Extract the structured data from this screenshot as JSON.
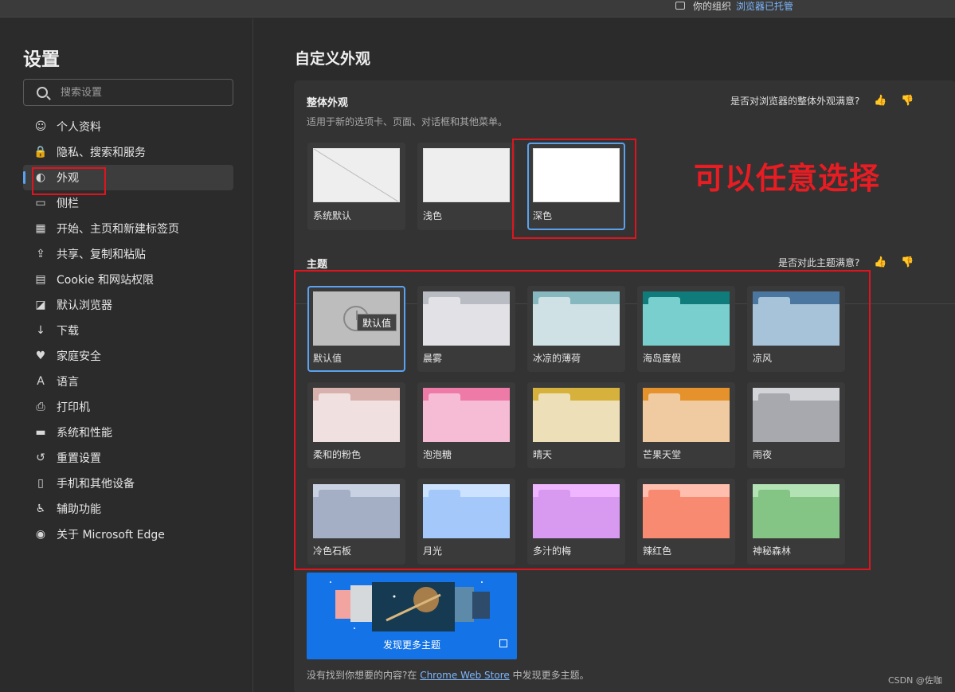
{
  "topbar": {
    "managed_prefix": "你的组织",
    "managed_link": "浏览器已托管"
  },
  "sidebar": {
    "title": "设置",
    "search_placeholder": "搜索设置",
    "items": [
      {
        "label": "个人资料",
        "icon": "profile-icon"
      },
      {
        "label": "隐私、搜索和服务",
        "icon": "lock-icon"
      },
      {
        "label": "外观",
        "icon": "palette-icon",
        "active": true
      },
      {
        "label": "侧栏",
        "icon": "sidebar-icon"
      },
      {
        "label": "开始、主页和新建标签页",
        "icon": "home-grid-icon"
      },
      {
        "label": "共享、复制和粘贴",
        "icon": "share-icon"
      },
      {
        "label": "Cookie 和网站权限",
        "icon": "site-permissions-icon"
      },
      {
        "label": "默认浏览器",
        "icon": "browser-icon"
      },
      {
        "label": "下载",
        "icon": "download-icon"
      },
      {
        "label": "家庭安全",
        "icon": "family-icon"
      },
      {
        "label": "语言",
        "icon": "language-icon"
      },
      {
        "label": "打印机",
        "icon": "printer-icon"
      },
      {
        "label": "系统和性能",
        "icon": "laptop-icon"
      },
      {
        "label": "重置设置",
        "icon": "reset-icon"
      },
      {
        "label": "手机和其他设备",
        "icon": "phone-icon"
      },
      {
        "label": "辅助功能",
        "icon": "accessibility-icon"
      },
      {
        "label": "关于 Microsoft Edge",
        "icon": "edge-logo-icon"
      }
    ]
  },
  "main": {
    "page_title": "自定义外观",
    "appearance": {
      "title": "整体外观",
      "description": "适用于新的选项卡、页面、对话框和其他菜单。",
      "feedback": "是否对浏览器的整体外观满意?",
      "options": [
        {
          "label": "系统默认"
        },
        {
          "label": "浅色"
        },
        {
          "label": "深色",
          "selected": true
        }
      ]
    },
    "themes": {
      "title": "主题",
      "feedback": "是否对此主题满意?",
      "tooltip": "默认值",
      "items": [
        {
          "label": "默认值",
          "selected": true,
          "bar": "#bdbdbd",
          "tab": "#bdbdbd",
          "body": "#bdbdbd"
        },
        {
          "label": "晨雾",
          "bar": "#b9bcc2",
          "tab": "#e2e2e6",
          "body": "#e2e2e6"
        },
        {
          "label": "冰凉的薄荷",
          "bar": "#86b8c0",
          "tab": "#cfe1e4",
          "body": "#cfe1e4"
        },
        {
          "label": "海岛度假",
          "bar": "#0f7b7b",
          "tab": "#78cfcd",
          "body": "#78cfcd"
        },
        {
          "label": "凉风",
          "bar": "#4a76a0",
          "tab": "#a7c3d9",
          "body": "#a7c3d9"
        },
        {
          "label": "柔和的粉色",
          "bar": "#d8b1ad",
          "tab": "#f0e0df",
          "body": "#f0e0df"
        },
        {
          "label": "泡泡糖",
          "bar": "#ee7aa8",
          "tab": "#f7bcd5",
          "body": "#f7bcd5"
        },
        {
          "label": "晴天",
          "bar": "#d6b23c",
          "tab": "#ede0b8",
          "body": "#ede0b8"
        },
        {
          "label": "芒果天堂",
          "bar": "#e6922c",
          "tab": "#f0cba1",
          "body": "#f0cba1"
        },
        {
          "label": "雨夜",
          "bar": "#d3d4d8",
          "tab": "#a8a9ae",
          "body": "#a8a9ae"
        },
        {
          "label": "冷色石板",
          "bar": "#c9d2e2",
          "tab": "#a4afc6",
          "body": "#a4afc6"
        },
        {
          "label": "月光",
          "bar": "#cce2ff",
          "tab": "#a5c8fb",
          "body": "#a5c8fb"
        },
        {
          "label": "多汁的梅",
          "bar": "#efb6ff",
          "tab": "#d89af0",
          "body": "#d89af0"
        },
        {
          "label": "辣红色",
          "bar": "#ffbeae",
          "tab": "#f98a72",
          "body": "#f98a72"
        },
        {
          "label": "神秘森林",
          "bar": "#b3e2b4",
          "tab": "#84c586",
          "body": "#84c586"
        }
      ]
    },
    "discover": {
      "label": "发现更多主题"
    },
    "store_note": {
      "before": "没有找到你想要的内容?在 ",
      "link": "Chrome Web Store",
      "after": " 中发现更多主题。"
    }
  },
  "annotation": {
    "text": "可以任意选择"
  },
  "watermark": "CSDN @佐咖",
  "colors": {
    "accent": "#5aa2f0",
    "annotation_red": "#e0141e",
    "discover_blue": "#1473e6"
  }
}
